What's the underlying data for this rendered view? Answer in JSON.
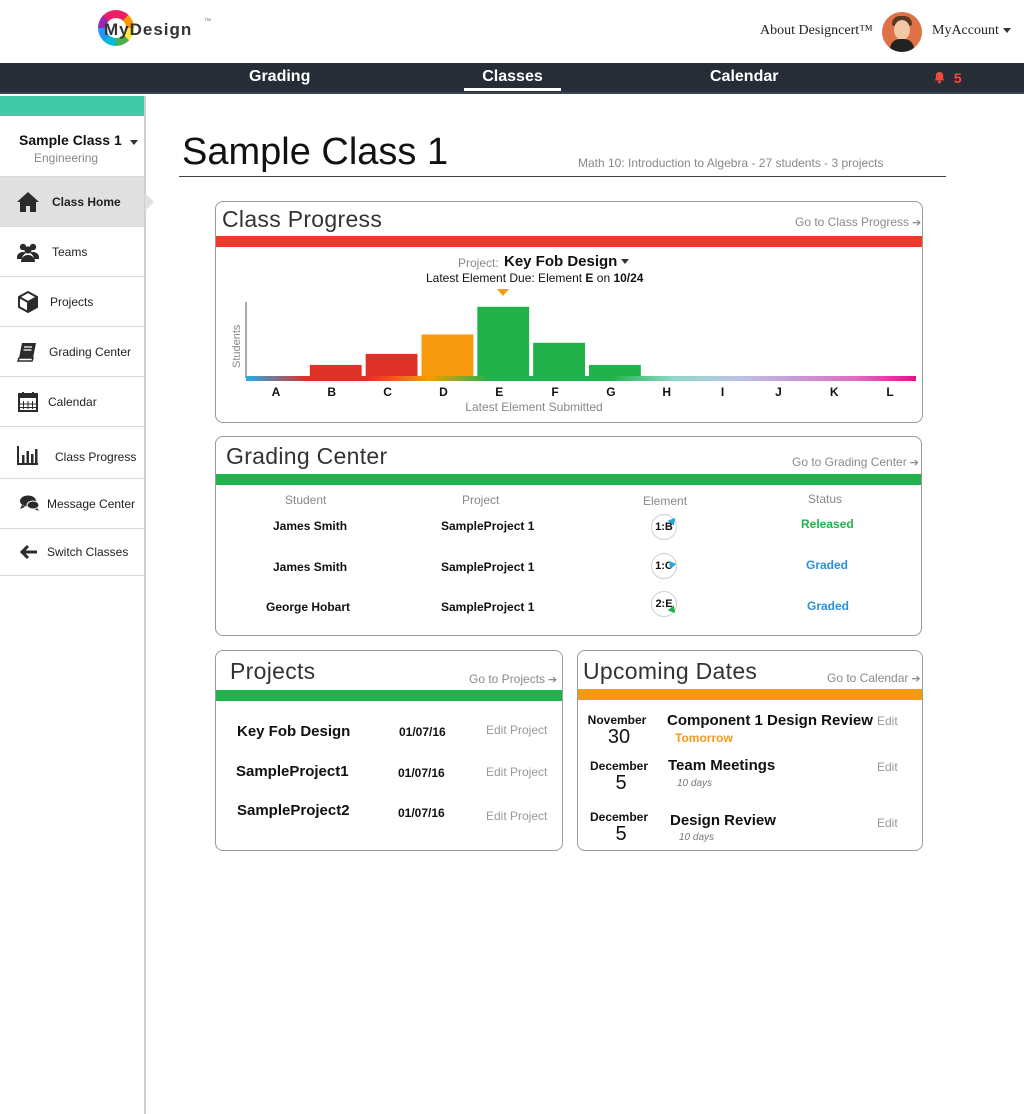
{
  "header": {
    "logo_text": "MyDesign",
    "logo_tm": "™",
    "about_label": "About Designcert™",
    "account_label": "MyAccount"
  },
  "nav": {
    "tabs": [
      {
        "label": "Grading"
      },
      {
        "label": "Classes"
      },
      {
        "label": "Calendar"
      }
    ],
    "active_tab": "Classes",
    "alert_count": "5"
  },
  "sidebar": {
    "class_name": "Sample Class 1",
    "class_subject": "Engineering",
    "items": [
      {
        "label": "Class Home",
        "icon": "home-icon"
      },
      {
        "label": "Teams",
        "icon": "users-icon"
      },
      {
        "label": "Projects",
        "icon": "cube-icon"
      },
      {
        "label": "Grading Center",
        "icon": "book-icon"
      },
      {
        "label": "Calendar",
        "icon": "calendar-icon"
      },
      {
        "label": "Class Progress",
        "icon": "bar-chart-icon"
      },
      {
        "label": "Message Center",
        "icon": "chat-icon"
      },
      {
        "label": "Switch Classes",
        "icon": "arrow-left-icon"
      }
    ],
    "active_item": "Class Home"
  },
  "page": {
    "title": "Sample Class 1",
    "meta": "Math 10: Introduction to Algebra -  27 students - 3 projects"
  },
  "class_progress": {
    "title": "Class Progress",
    "link": "Go to Class Progress",
    "project_label": "Project:",
    "project_name": "Key Fob Design",
    "due_prefix": "Latest Element Due: Element ",
    "due_element": "E",
    "due_on": " on ",
    "due_date": "10/24",
    "bar_color": "#ee3a2c"
  },
  "chart_data": {
    "type": "bar",
    "categories": [
      "A",
      "B",
      "C",
      "D",
      "E",
      "F",
      "G",
      "H",
      "I",
      "J",
      "K",
      "L"
    ],
    "values": [
      0,
      2,
      4,
      7.5,
      12.5,
      6,
      2,
      0,
      0,
      0,
      0,
      0
    ],
    "colors": [
      "#22aee6",
      "#de3127",
      "#de3127",
      "#f79a0e",
      "#21b24b",
      "#21b24b",
      "#21b24b",
      "#8fd8c8",
      "#b9c6e3",
      "#c79ad8",
      "#de6fc4",
      "#e5118a"
    ],
    "xlabel": "Latest Element Submitted",
    "ylabel": "Students",
    "ylim": [
      0,
      13
    ],
    "grid": false,
    "legend": "none"
  },
  "grading_center": {
    "title": "Grading Center",
    "link": "Go to Grading Center",
    "bar_color": "#21b24b",
    "columns": [
      "Student",
      "Project",
      "Element",
      "Status"
    ],
    "rows": [
      {
        "student": "James Smith",
        "project": "SampleProject 1",
        "element": "1:B",
        "status": "Released",
        "status_color": "#21b24b",
        "tick_color": "#21a9d8"
      },
      {
        "student": "James Smith",
        "project": "SampleProject 1",
        "element": "1:C",
        "status": "Graded",
        "status_color": "#2a8fdc",
        "tick_color": "#21a9d8"
      },
      {
        "student": "George Hobart",
        "project": "SampleProject 1",
        "element": "2:E",
        "status": "Graded",
        "status_color": "#2a8fdc",
        "tick_color": "#21b24b"
      }
    ]
  },
  "projects": {
    "title": "Projects",
    "link": "Go to Projects",
    "bar_color": "#21b24b",
    "edit_label": "Edit Project",
    "items": [
      {
        "name": "Key Fob Design",
        "date": "01/07/16"
      },
      {
        "name": "SampleProject1",
        "date": "01/07/16"
      },
      {
        "name": "SampleProject2",
        "date": "01/07/16"
      }
    ]
  },
  "upcoming": {
    "title": "Upcoming Dates",
    "link": "Go to Calendar",
    "bar_color": "#f39a0e",
    "edit_label": "Edit",
    "items": [
      {
        "month": "November",
        "day": "30",
        "event": "Component 1 Design Review",
        "when": "Tomorrow"
      },
      {
        "month": "December",
        "day": "5",
        "event": "Team Meetings",
        "when": "10 days"
      },
      {
        "month": "December",
        "day": "5",
        "event": "Design Review",
        "when": "10 days"
      }
    ]
  }
}
